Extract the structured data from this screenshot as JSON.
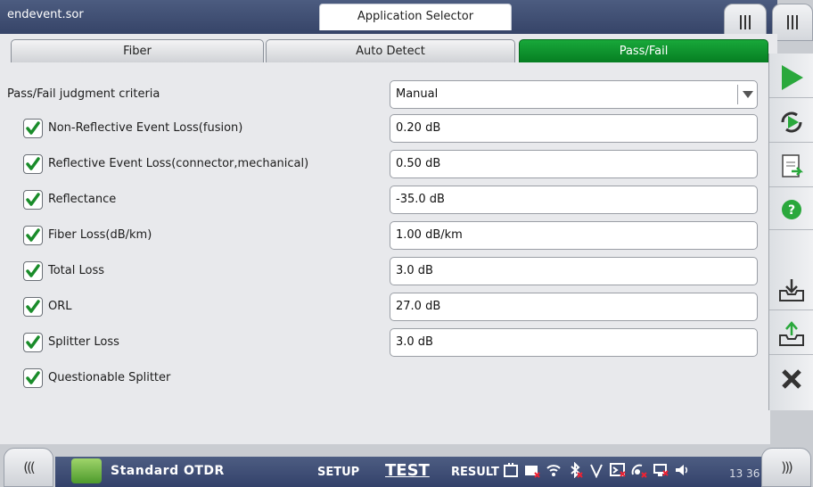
{
  "window": {
    "filename": "endevent.sor",
    "app_selector_label": "Application Selector"
  },
  "tabs": [
    {
      "label": "Fiber",
      "active": false
    },
    {
      "label": "Auto Detect",
      "active": false
    },
    {
      "label": "Pass/Fail",
      "active": true
    }
  ],
  "criteria": {
    "label": "Pass/Fail judgment criteria",
    "value": "Manual"
  },
  "thresholds": [
    {
      "label": "Non-Reflective Event Loss(fusion)",
      "checked": true,
      "value": "0.20 dB"
    },
    {
      "label": "Reflective Event Loss(connector,mechanical)",
      "checked": true,
      "value": "0.50 dB"
    },
    {
      "label": "Reflectance",
      "checked": true,
      "value": "-35.0 dB"
    },
    {
      "label": "Fiber Loss(dB/km)",
      "checked": true,
      "value": "1.00 dB/km"
    },
    {
      "label": "Total Loss",
      "checked": true,
      "value": "3.0 dB"
    },
    {
      "label": "ORL",
      "checked": true,
      "value": "27.0 dB"
    },
    {
      "label": "Splitter Loss",
      "checked": true,
      "value": "3.0 dB"
    },
    {
      "label": "Questionable Splitter",
      "checked": true
    }
  ],
  "toolbar": {
    "buttons": [
      "play-icon",
      "refresh-play-icon",
      "report-icon",
      "help-icon",
      "save-tray-icon",
      "upload-tray-icon",
      "close-icon"
    ]
  },
  "bottom": {
    "app_name": "Standard OTDR",
    "nav_setup": "SETUP",
    "nav_test": "TEST",
    "nav_result": "RESULT",
    "clock": "13 36",
    "left_arrow": "(((",
    "right_arrow": ")))"
  },
  "colors": {
    "accent_green": "#0a8f2c",
    "header_blue": "#3f4e74",
    "check_green": "#1a8c2a"
  }
}
